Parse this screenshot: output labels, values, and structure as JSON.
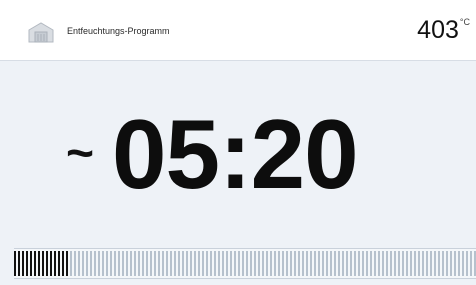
{
  "header": {
    "icon": "oven-icon",
    "program_title": "Entfeuchtungs-Programm",
    "temperature": "403",
    "temperature_unit": "°C"
  },
  "timer": {
    "prefix": "~",
    "remaining_time": "05:20"
  },
  "progress": {
    "fraction": 0.12
  },
  "colors": {
    "background": "#eef2f7",
    "header_background": "#ffffff",
    "progress_active": "#111111",
    "progress_inactive": "#b6c1cd"
  }
}
